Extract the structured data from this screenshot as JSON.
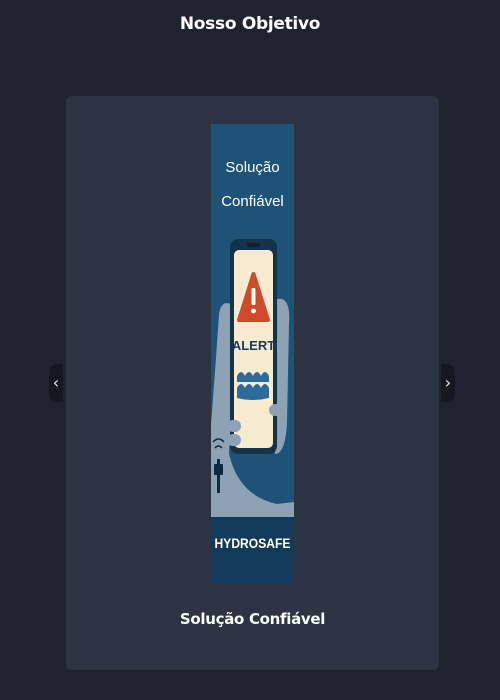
{
  "page": {
    "title": "Nosso Objetivo"
  },
  "carousel": {
    "prev_icon": "‹",
    "next_icon": "›",
    "slide": {
      "caption": "Solução Confiável",
      "poster": {
        "heading_line1": "Solução",
        "heading_line2": "Confiável",
        "alert_label": "ALERT",
        "brand": "HYDROSAFE"
      }
    }
  },
  "colors": {
    "background": "#1e2330",
    "card": "#2c3443",
    "poster_bg": "#1f5277",
    "poster_bar": "#133a58",
    "phone_screen": "#f6ead1",
    "alert_red": "#cf4a2c"
  }
}
